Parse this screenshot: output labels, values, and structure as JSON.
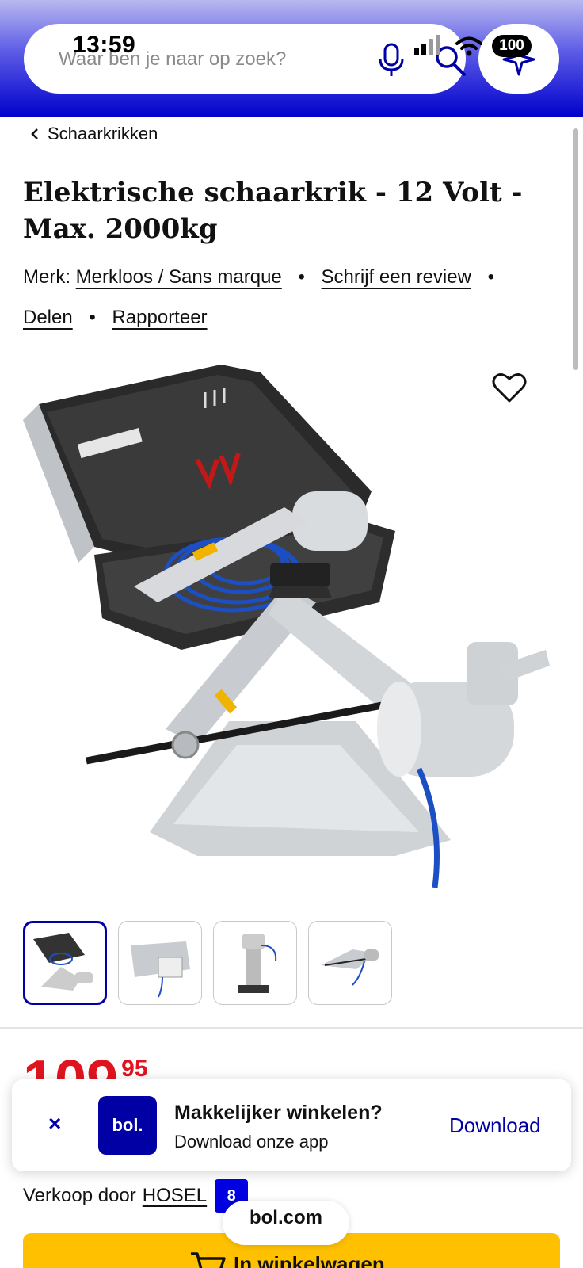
{
  "status_bar": {
    "time": "13:59",
    "battery": "100"
  },
  "search": {
    "placeholder": "Waar ben je naar op zoek?"
  },
  "breadcrumb": {
    "label": "Schaarkrikken"
  },
  "product": {
    "title_line1": "Elektrische schaarkrik - 12 Volt -",
    "title_line2": "Max. 2000kg",
    "brand_prefix": "Merk:",
    "brand": "Merkloos / Sans marque",
    "review_link": "Schrijf een review",
    "share_link": "Delen",
    "report_link": "Rapporteer"
  },
  "price": {
    "main": "109",
    "cents": "95"
  },
  "app_banner": {
    "close": "×",
    "logo_text": "bol.",
    "title": "Makkelijker winkelen?",
    "subtitle": "Download onze app",
    "download": "Download"
  },
  "seller": {
    "prefix": "Verkoop door",
    "name": "HOSEL",
    "score": "8"
  },
  "cart": {
    "label": "In winkelwagen"
  },
  "footer_pill": {
    "label": "bol.com"
  },
  "colors": {
    "brand_blue": "#0000a4",
    "price_red": "#e0141e",
    "cart_yellow": "#ffc000"
  }
}
